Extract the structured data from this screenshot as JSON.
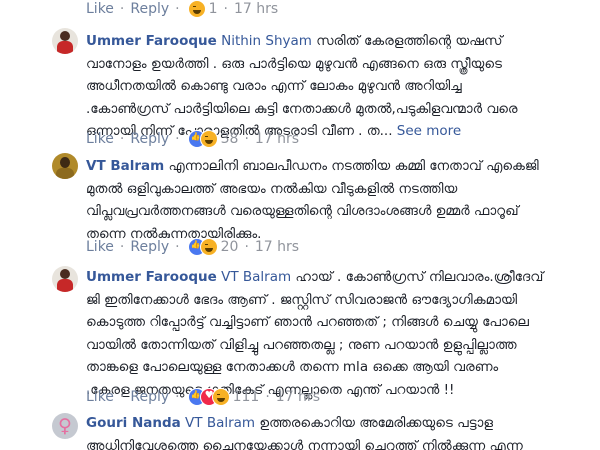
{
  "comments": [
    {
      "meta": {
        "like": "Like",
        "reply": "Reply",
        "count": "1",
        "time": "17 hrs"
      }
    },
    {
      "author": "Ummer Farooque",
      "tag": "Nithin Shyam",
      "lines": [
        "സരിത് കേരളത്തിന്റെ യഷസ്",
        "വാനോളം ഉയർത്തി . ഒരു പാർട്ടിയെ മുഴുവൻ എങ്ങനെ ഒരു സ്ത്രീയുടെ",
        "അധീനതയിൽ കൊണ്ടു വരാം എന്ന് ലോകം മുഴുവൻ അറിയിച്ച",
        ".കോൺഗ്രസ് പാർട്ടിയിലെ കുട്ടി നേതാക്കൾ മുതൽ,പടുകിളവന്മാർ വരെ",
        "ഒന്നായി നിന്ന് പോരാളതിൽ അടരാടി വീണ . ത..."
      ],
      "see_more": "See more",
      "meta": {
        "like": "Like",
        "reply": "Reply",
        "count": "38",
        "time": "17 hrs"
      }
    },
    {
      "author": "VT Balram",
      "lines": [
        "എന്നാലിനി ബാലപീഡനം നടത്തിയ കമ്മി നേതാവ് എകെജി",
        "മുതൽ ഒളിവുകാലത്ത് അഭയം നൽകിയ വീടുകളിൽ നടത്തിയ",
        "വിപ്ലവപ്രവർത്തനങ്ങൾ വരെയുള്ളതിന്റെ വിശദാംശങ്ങൾ ഉമ്മർ ഫാറൂഖ്",
        "തന്നെ നൽകുന്നതായിരിക്കും."
      ],
      "meta": {
        "like": "Like",
        "reply": "Reply",
        "count": "20",
        "time": "17 hrs"
      }
    },
    {
      "author": "Ummer Farooque",
      "tag": "VT Balram",
      "lines": [
        "ഹായ് . കോൺഗ്രസ് നിലവാരം.ശ്രീദേവ്",
        "ജി ഇതിനേക്കാൾ ഭേദം ആണ് . ജസ്റ്റിസ് സിവരാജൻ ഔദ്യോഗികമായി",
        "കൊടുത്ത റിപ്പോർട്ട് വച്ചിട്ടാണ് ഞാൻ പറഞ്ഞത് ; നിങ്ങൾ ചെയ്യു പോലെ",
        "വായിൽ തോന്നിയത് വിളിച്ചു പറഞ്ഞതല്ല ; നുണ പറയാൻ ഉളുപ്പില്ലാത്ത",
        "താങ്കളെ പോലെയുള്ള നേതാക്കൾ തന്നെ mla ഒക്കെ ആയി വരണം",
        ".കേരള ജനതയുടെ ഗതികേട് എന്നല്ലാതെ എന്ത് പറയാൻ !!"
      ],
      "meta": {
        "like": "Like",
        "reply": "Reply",
        "count": "111",
        "time": "17 hrs"
      }
    },
    {
      "author": "Gouri Nanda",
      "tag": "VT Balram",
      "lines": [
        "ഉത്തരകൊറിയ അമേരിക്കയുടെ പട്ടാള",
        "അധിനിവേശത്തെ ചൈനയേക്കാൾ നന്നായി ചെറുത്ത് നിൽക്കുന്ന എന്ന"
      ]
    }
  ]
}
